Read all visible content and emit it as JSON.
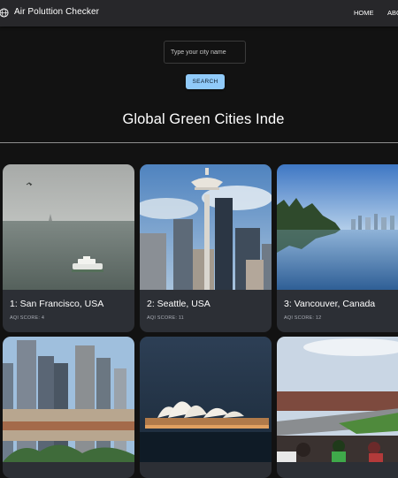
{
  "app": {
    "brand": "Air Poluttion Checker",
    "nav": {
      "home": "HOME",
      "about": "ABOUT"
    }
  },
  "search": {
    "placeholder": "Type your city name",
    "button_label": "SEARCH"
  },
  "page_title": "Global Green Cities Inde",
  "cities": [
    {
      "name": "1: San Francisco, USA",
      "score": "AQI SCORE: 4",
      "image": "san-francisco-bay-ferry"
    },
    {
      "name": "2: Seattle, USA",
      "score": "AQI SCORE: 11",
      "image": "seattle-space-needle"
    },
    {
      "name": "3: Vancouver, Canada",
      "score": "AQI SCORE: 12",
      "image": "vancouver-waterfront"
    },
    {
      "name": "",
      "score": "",
      "image": "melbourne-skyline"
    },
    {
      "name": "",
      "score": "",
      "image": "sydney-opera-house"
    },
    {
      "name": "",
      "score": "",
      "image": "race-track-crowd"
    }
  ],
  "colors": {
    "navbar_bg": "#27272a",
    "page_bg": "#121212",
    "card_bg": "#2c2f35",
    "button_bg": "#90caf9"
  }
}
